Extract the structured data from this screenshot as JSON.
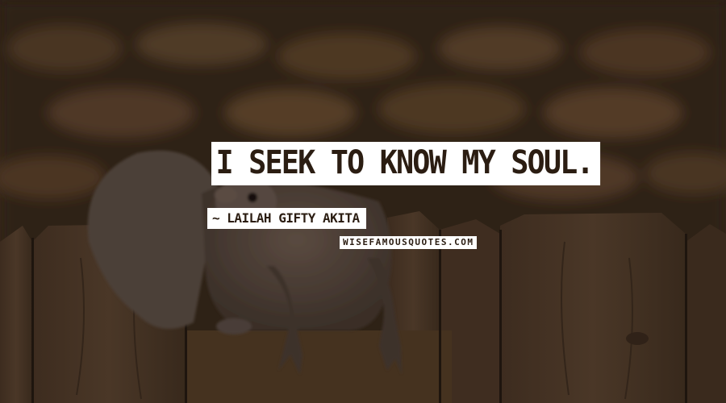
{
  "quote": {
    "text": "I SEEK TO KNOW MY SOUL.",
    "author": "~ LAILAH GIFTY AKITA",
    "source": "WISEFAMOUSQUOTES.COM"
  },
  "colors": {
    "label_background": "#ffffff",
    "label_text": "#2b1d12",
    "overlay": "#2a1d14"
  }
}
